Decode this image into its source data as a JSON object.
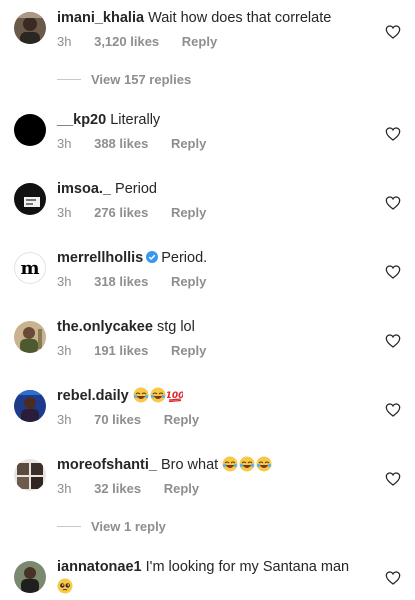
{
  "comments": [
    {
      "username": "imani_khalia",
      "text": "Wait how does that correlate",
      "time": "3h",
      "likes": "3,120 likes",
      "reply": "Reply",
      "view_replies": "View 157 replies"
    },
    {
      "username": "__kp20",
      "text": "Literally",
      "time": "3h",
      "likes": "388 likes",
      "reply": "Reply"
    },
    {
      "username": "imsoa._",
      "text": "Period",
      "time": "3h",
      "likes": "276 likes",
      "reply": "Reply"
    },
    {
      "username": "merrellhollis",
      "text": "Period.",
      "time": "3h",
      "likes": "318 likes",
      "reply": "Reply",
      "verified": true
    },
    {
      "username": "the.onlycakee",
      "text": "stg lol",
      "time": "3h",
      "likes": "191 likes",
      "reply": "Reply"
    },
    {
      "username": "rebel.daily",
      "text": "",
      "emojis": [
        "laughing-emoji",
        "laughing-emoji",
        "hundred-points-emoji"
      ],
      "time": "3h",
      "likes": "70 likes",
      "reply": "Reply"
    },
    {
      "username": "moreofshanti_",
      "text": "Bro what",
      "emojis": [
        "laughing-emoji",
        "laughing-emoji",
        "laughing-emoji"
      ],
      "time": "3h",
      "likes": "32 likes",
      "reply": "Reply",
      "view_replies": "View 1 reply"
    },
    {
      "username": "iannatonae1",
      "text": "I'm looking for my Santana man",
      "emojis_line2": [
        "pleading-face-emoji"
      ]
    }
  ],
  "colors": {
    "text": "#262626",
    "secondary": "#8e8e8e",
    "verified": "#3897f0"
  }
}
